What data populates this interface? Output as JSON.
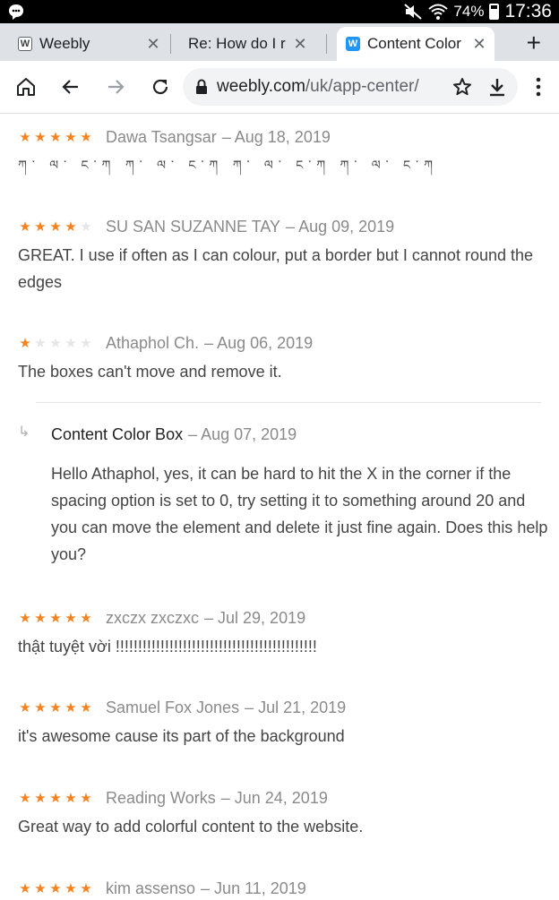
{
  "status_bar": {
    "battery": "74%",
    "time": "17:36"
  },
  "tabs": [
    {
      "label": "Weebly",
      "favicon": "W",
      "active": false
    },
    {
      "label": "Re: How do I r",
      "favicon": "",
      "active": false
    },
    {
      "label": "Content Color",
      "favicon": "W",
      "active": true
    }
  ],
  "toolbar": {
    "url_domain": "weebly.com",
    "url_path": "/uk/app-center/"
  },
  "colors": {
    "star": "#f5821f",
    "star_off": "#e6e6e6",
    "meta_text": "#8a8a8a",
    "body_text": "#444444"
  },
  "reviews": [
    {
      "rating": 5,
      "author": "Dawa Tsangsar",
      "date": "– Aug 18, 2019",
      "text": "ཀ་ ལ་ ང་ཀ ཀ་ ལ་ ང་ཀ ཀ་ ལ་ ང་ཀ ཀ་ ལ་ ང་ཀ"
    },
    {
      "rating": 4,
      "author": "SU SAN SUZANNE TAY",
      "date": "– Aug 09, 2019",
      "text": "GREAT. I use if often as I can colour, put a border but I cannot round the edges"
    },
    {
      "rating": 1,
      "author": "Athaphol Ch.",
      "date": "– Aug 06, 2019",
      "text": "The boxes can't move and remove it."
    },
    {
      "rating": 5,
      "author": "zxczx zxczxc",
      "date": "– Jul 29, 2019",
      "text": "thật tuyệt vời !!!!!!!!!!!!!!!!!!!!!!!!!!!!!!!!!!!!!!!!!!!!!"
    },
    {
      "rating": 5,
      "author": "Samuel Fox Jones",
      "date": "– Jul 21, 2019",
      "text": "it's awesome cause its part of the background"
    },
    {
      "rating": 5,
      "author": "Reading Works",
      "date": "– Jun 24, 2019",
      "text": "Great way to add colorful content to the website."
    },
    {
      "rating": 5,
      "author": "kim assenso",
      "date": "– Jun 11, 2019",
      "text": ""
    }
  ],
  "reply": {
    "author": "Content Color Box",
    "date": "– Aug 07, 2019",
    "text": "Hello Athaphol, yes, it can be hard to hit the X in the corner if the spacing option is set to 0, try setting it to something around 20 and you can move the element and delete it just fine again. Does this help you?"
  }
}
